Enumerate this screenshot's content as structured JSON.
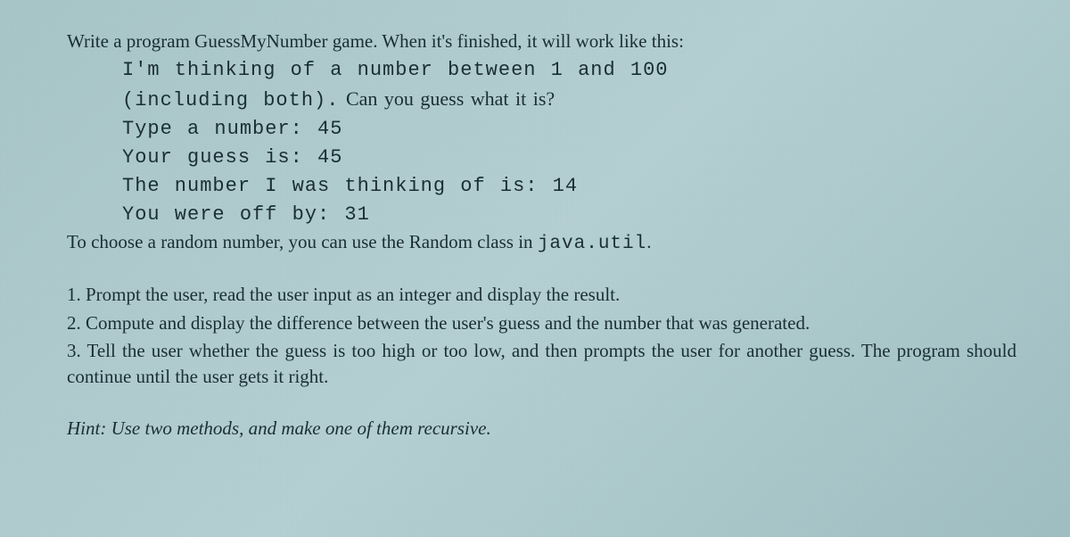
{
  "intro": {
    "text": "Write a program GuessMyNumber game. When it's finished, it will work like this:"
  },
  "code": {
    "line1": "I'm thinking of a number between 1 and 100",
    "line2_a": "(including both).",
    "line2_b": " Can you guess what it is?",
    "line3": "Type a number: 45",
    "line4": "Your guess is: 45",
    "line5": "The number I was thinking of is: 14",
    "line6": "You were off by: 31"
  },
  "outro": {
    "text_a": "To choose a random number, you can use the Random class in ",
    "text_b": "java.util",
    "text_c": "."
  },
  "list": {
    "item1": "1. Prompt the user, read the user input as an integer and display the result.",
    "item2": "2. Compute and display the difference between the user's guess and the number that was generated.",
    "item3": "3. Tell the user whether the guess is too high or too low, and then prompts the user for another guess. The program should continue until the user gets it right."
  },
  "hint": {
    "text": "Hint: Use two methods, and make one of them recursive."
  }
}
